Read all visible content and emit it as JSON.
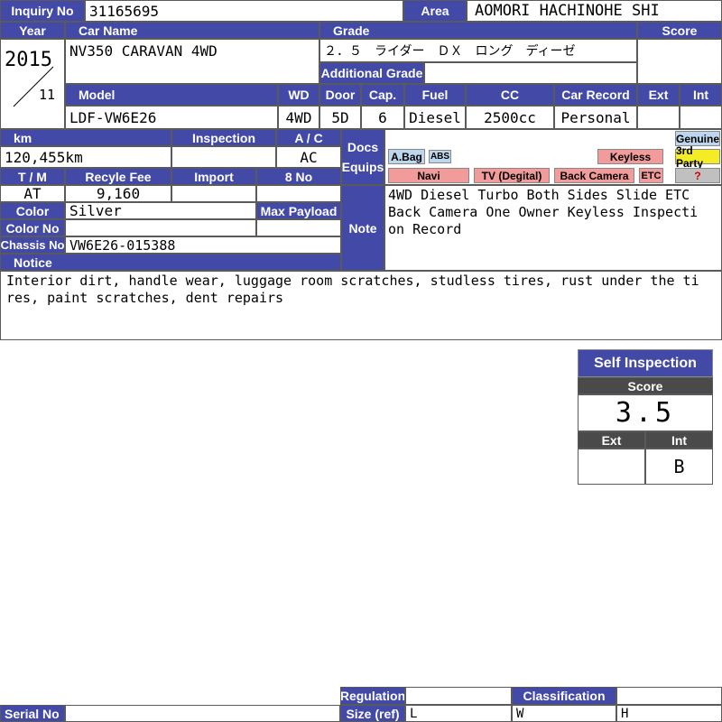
{
  "labels": {
    "inquiry_no": "Inquiry No",
    "area": "Area",
    "year": "Year",
    "car_name": "Car Name",
    "grade": "Grade",
    "score": "Score",
    "additional_grade": "Additional Grade",
    "model": "Model",
    "wd": "WD",
    "door": "Door",
    "cap": "Cap.",
    "fuel": "Fuel",
    "cc": "CC",
    "car_record": "Car Record",
    "ext": "Ext",
    "int": "Int",
    "km": "km",
    "inspection": "Inspection",
    "ac": "A / C",
    "docs": "Docs",
    "equips": "Equips",
    "tm": "T / M",
    "recycle_fee": "Recyle Fee",
    "import": "Import",
    "no8": "8 No",
    "color": "Color",
    "max_payload": "Max Payload",
    "color_no": "Color No",
    "note": "Note",
    "chassis_no": "Chassis No",
    "notice": "Notice",
    "regulation": "Regulation",
    "classification": "Classification",
    "serial_no": "Serial No",
    "size_ref": "Size (ref)"
  },
  "values": {
    "inquiry_no": "31165695",
    "area": "AOMORI HACHINOHE SHI",
    "year": "2015",
    "month": "11",
    "car_name": "NV350 CARAVAN 4WD",
    "grade": "２．５　ライダー　ＤＸ　ロング　ディーゼ",
    "additional_grade": "",
    "score": "",
    "model": "LDF-VW6E26",
    "wd": "4WD",
    "door": "5D",
    "cap": "6",
    "fuel": "Diesel",
    "cc": "2500cc",
    "car_record": "Personal",
    "ext": "",
    "int": "",
    "km": "120,455km",
    "inspection": "",
    "ac": "AC",
    "tm": "AT",
    "recycle_fee": "9,160",
    "import": "",
    "no8": "",
    "color": "Silver",
    "max_payload": "",
    "color_no": "",
    "chassis_no": "VW6E26-015388",
    "note": "4WD Diesel Turbo Both Sides Slide ETC Back Camera One Owner Keyless Inspection Record",
    "notice": "Interior dirt, handle wear, luggage room scratches, studless tires, rust under the tires, paint scratches, dent repairs",
    "serial_no": "",
    "size_l": "L",
    "size_w": "W",
    "size_h": "H"
  },
  "equips": {
    "abag": "A.Bag",
    "abs": "ABS",
    "keyless": "Keyless",
    "genuine": "Genuine",
    "third_party": "3rd Party",
    "navi": "Navi",
    "tv": "TV (Degital)",
    "back_camera": "Back Camera",
    "etc": "ETC",
    "unknown": "?"
  },
  "self_inspection": {
    "title": "Self Inspection",
    "score_label": "Score",
    "score": "3.5",
    "ext_label": "Ext",
    "int_label": "Int",
    "ext": "",
    "int": "B"
  },
  "colors": {
    "header": "#4249a6",
    "tag_blue": "#bcd6ee",
    "tag_red": "#f29b9b",
    "tag_yellow": "#f4ec25",
    "dark": "#4a4a4a"
  }
}
